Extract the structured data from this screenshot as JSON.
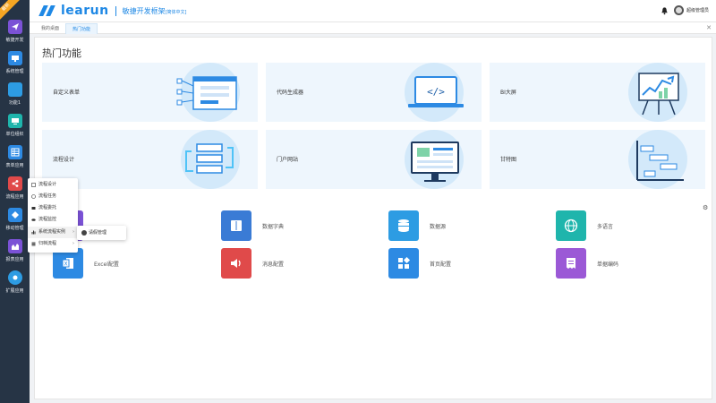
{
  "app": {
    "ribbon": "最新",
    "brand": "learun",
    "subtitle": "敏捷开发框架",
    "edition": "[简体中文]",
    "user": "超级管理员"
  },
  "sidebar": {
    "items": [
      {
        "label": "敏捷开发",
        "icon": "paper-plane-icon",
        "color": "#7b52d6"
      },
      {
        "label": "系统管理",
        "icon": "monitor-icon",
        "color": "#2d8ae3"
      },
      {
        "label": "功能1",
        "icon": "square-icon",
        "color": "#2d9ce3"
      },
      {
        "label": "单位组织",
        "icon": "org-icon",
        "color": "#1fb5ac"
      },
      {
        "label": "表单应用",
        "icon": "table-icon",
        "color": "#2d8ae3"
      },
      {
        "label": "流程应用",
        "icon": "share-icon",
        "color": "#e04a4a"
      },
      {
        "label": "移动管理",
        "icon": "mobile-icon",
        "color": "#2d8ae3"
      },
      {
        "label": "报表应用",
        "icon": "chart-icon",
        "color": "#7b52d6"
      },
      {
        "label": "扩展应用",
        "icon": "extension-icon",
        "color": "#2d9ce3"
      }
    ]
  },
  "tabs": [
    {
      "label": "我的桌面"
    },
    {
      "label": "热门功能"
    }
  ],
  "main": {
    "title": "热门功能",
    "cards": [
      {
        "label": "自定义表单",
        "illustration": "form-builder-illustration"
      },
      {
        "label": "代码生成器",
        "illustration": "code-generator-illustration"
      },
      {
        "label": "BI大屏",
        "illustration": "bi-screen-illustration"
      },
      {
        "label": "流程设计",
        "illustration": "workflow-illustration"
      },
      {
        "label": "门户网站",
        "illustration": "portal-illustration"
      },
      {
        "label": "甘特图",
        "illustration": "gantt-illustration"
      }
    ],
    "apps": [
      {
        "label": "",
        "icon": "purple-icon",
        "color": "#7b52d6"
      },
      {
        "label": "数据字典",
        "icon": "book-icon",
        "color": "#3a7bd5"
      },
      {
        "label": "数据源",
        "icon": "database-icon",
        "color": "#2d9ce3"
      },
      {
        "label": "多语言",
        "icon": "globe-icon",
        "color": "#1fb5ac"
      },
      {
        "label": "Excel配置",
        "icon": "excel-icon",
        "color": "#2d8ae3"
      },
      {
        "label": "消息配置",
        "icon": "speaker-icon",
        "color": "#e04a4a"
      },
      {
        "label": "首页配置",
        "icon": "tiles-icon",
        "color": "#2d8ae3"
      },
      {
        "label": "单据编码",
        "icon": "receipt-icon",
        "color": "#9b59d6"
      }
    ]
  },
  "flyout": {
    "items": [
      {
        "label": "流程设计",
        "icon": "edit-icon",
        "has_sub": false
      },
      {
        "label": "流程任务",
        "icon": "task-icon",
        "has_sub": false
      },
      {
        "label": "流程委托",
        "icon": "delegate-icon",
        "has_sub": false
      },
      {
        "label": "流程监控",
        "icon": "eye-icon",
        "has_sub": false
      },
      {
        "label": "系统流程实例",
        "icon": "bar-chart-icon",
        "has_sub": true
      },
      {
        "label": "归档流程",
        "icon": "list-icon",
        "has_sub": true
      }
    ],
    "submenu": {
      "label": "请假管理",
      "icon": "user-circle-icon"
    }
  }
}
